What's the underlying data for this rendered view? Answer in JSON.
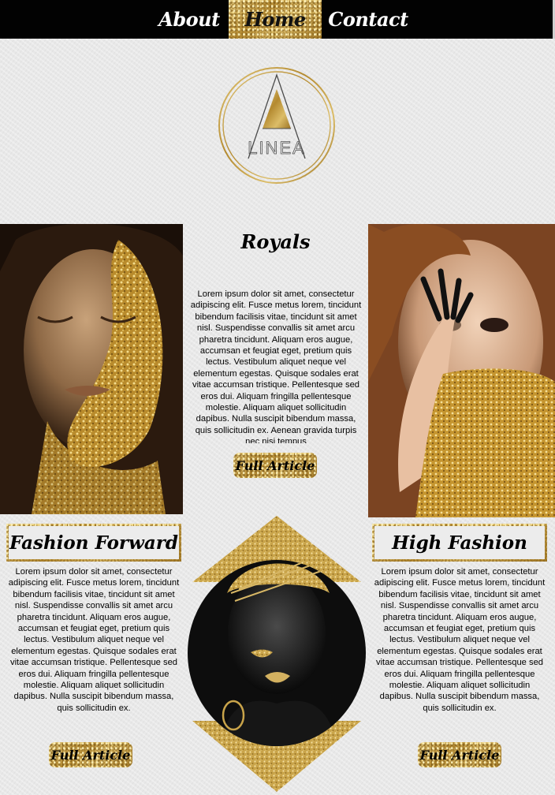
{
  "nav": {
    "about": "About",
    "home": "Home",
    "contact": "Contact"
  },
  "logo": {
    "text": "LINEA",
    "letter": "A"
  },
  "royals": {
    "title": "Royals",
    "body": "Lorem ipsum dolor sit amet, consectetur adipiscing elit. Fusce metus lorem, tincidunt bibendum facilisis vitae, tincidunt sit amet nisl. Suspendisse convallis sit amet arcu pharetra tincidunt. Aliquam eros augue, accumsan et feugiat eget, pretium quis lectus. Vestibulum aliquet neque vel elementum egestas. Quisque sodales erat vitae accumsan tristique. Pellentesque sed eros dui. Aliquam fringilla pellentesque molestie. Aliquam aliquet sollicitudin dapibus. Nulla suscipit bibendum massa, quis sollicitudin ex. Aenean gravida turpis nec nisi tempus",
    "button": "Full Article"
  },
  "fashion_forward": {
    "title": "Fashion Forward",
    "body": "Lorem ipsum dolor sit amet, consectetur adipiscing elit. Fusce metus lorem, tincidunt bibendum facilisis vitae, tincidunt sit amet nisl. Suspendisse convallis sit amet arcu pharetra tincidunt. Aliquam eros augue, accumsan et feugiat eget, pretium quis lectus. Vestibulum aliquet neque vel elementum egestas. Quisque sodales erat vitae accumsan tristique. Pellentesque sed eros dui. Aliquam fringilla pellentesque molestie. Aliquam aliquet sollicitudin dapibus. Nulla suscipit bibendum massa, quis sollicitudin ex.",
    "button": "Full Article"
  },
  "high_fashion": {
    "title": "High Fashion",
    "body": "Lorem ipsum dolor sit amet, consectetur adipiscing elit. Fusce metus lorem, tincidunt bibendum facilisis vitae, tincidunt sit amet nisl. Suspendisse convallis sit amet arcu pharetra tincidunt. Aliquam eros augue, accumsan et feugiat eget, pretium quis lectus. Vestibulum aliquet neque vel elementum egestas. Quisque sodales erat vitae accumsan tristique. Pellentesque sed eros dui. Aliquam fringilla pellentesque molestie. Aliquam aliquet sollicitudin dapibus. Nulla suscipit bibendum massa, quis sollicitudin ex.",
    "button": "Full Article"
  },
  "colors": {
    "nav_bg": "#020202",
    "gold": "#c9a548",
    "page_bg": "#e9e9e9"
  }
}
